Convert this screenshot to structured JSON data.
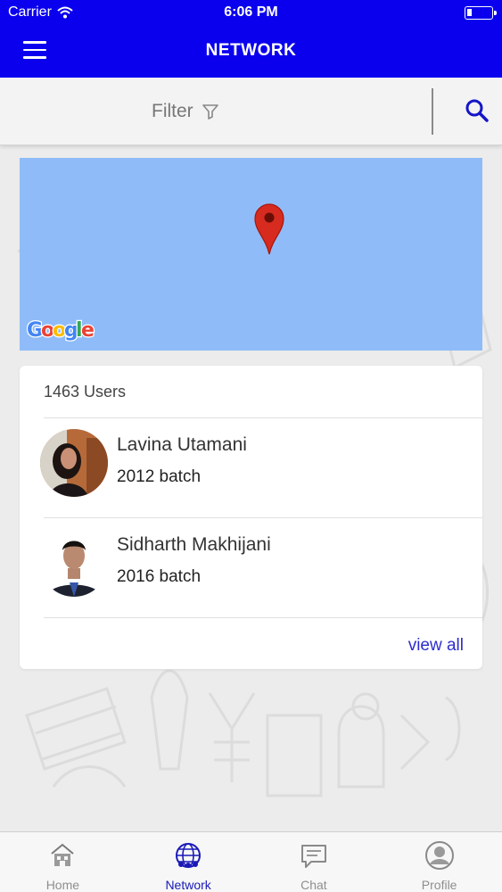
{
  "status_bar": {
    "carrier": "Carrier",
    "time": "6:06 PM"
  },
  "header": {
    "title": "NETWORK",
    "menu_icon": "hamburger-menu-icon"
  },
  "filter_bar": {
    "filter_label": "Filter",
    "filter_icon": "funnel-icon",
    "search_icon": "magnifier-icon"
  },
  "map": {
    "attribution": "Google",
    "pin_color": "#d62b1e"
  },
  "users": {
    "count_label": "1463 Users",
    "items": [
      {
        "name": "Lavina Utamani",
        "batch": "2012 batch"
      },
      {
        "name": "Sidharth Makhijani",
        "batch": "2016 batch"
      }
    ],
    "view_all_label": "view all"
  },
  "tabs": [
    {
      "label": "Home",
      "icon": "home-icon",
      "active": false
    },
    {
      "label": "Network",
      "icon": "globe-icon",
      "active": true
    },
    {
      "label": "Chat",
      "icon": "chat-bubble-icon",
      "active": false
    },
    {
      "label": "Profile",
      "icon": "profile-icon",
      "active": false
    }
  ],
  "colors": {
    "header_bg": "#0a00ee",
    "map_water": "#8fbcf8",
    "accent": "#1a1ab8"
  }
}
